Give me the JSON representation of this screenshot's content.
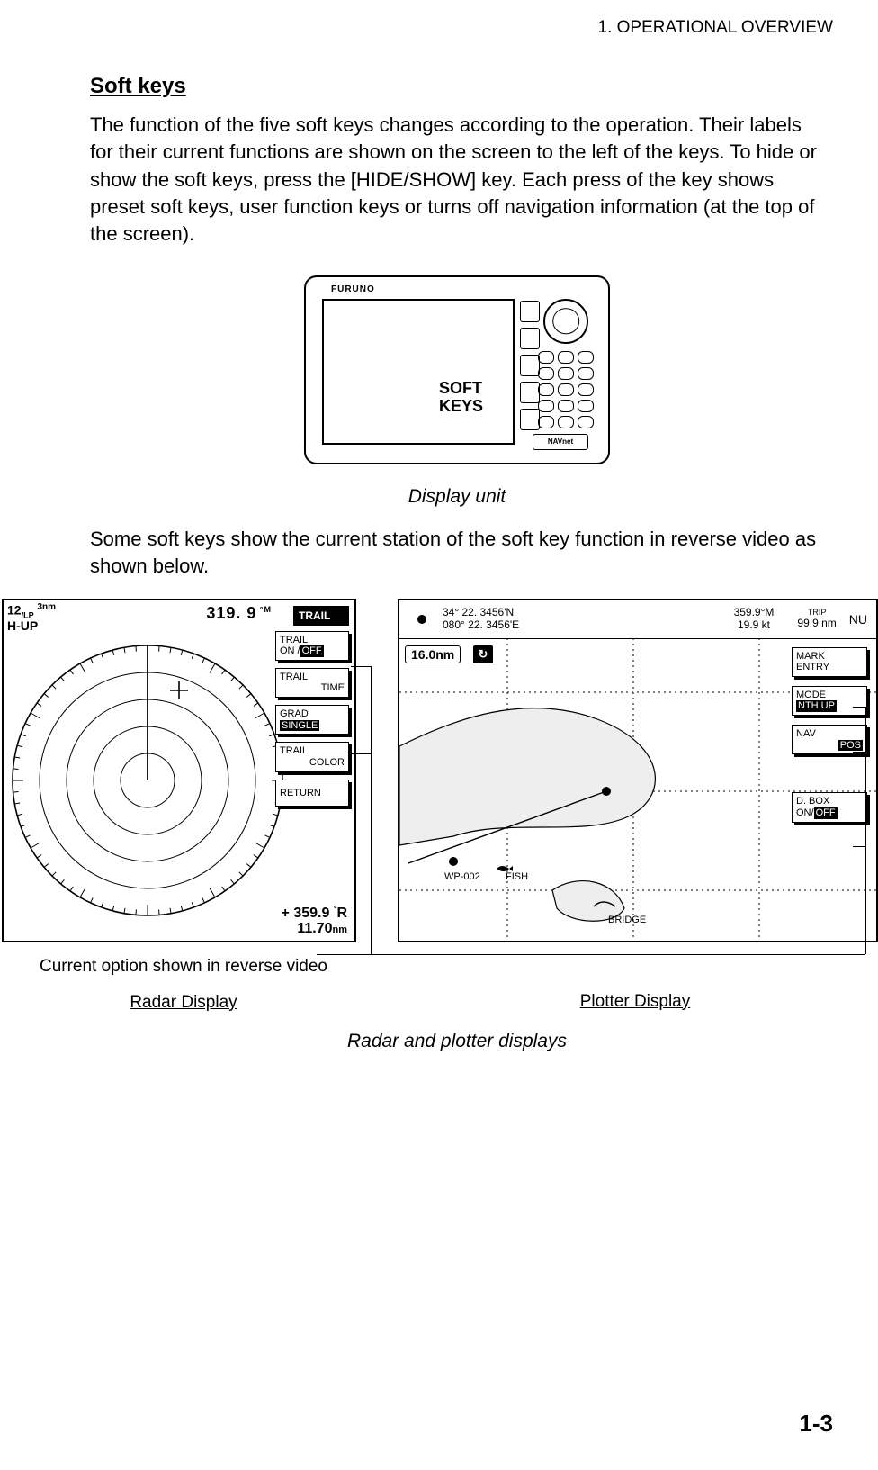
{
  "header": {
    "running": "1. OPERATIONAL OVERVIEW"
  },
  "section": {
    "title": "Soft keys"
  },
  "para1": "The function of the five soft keys changes according to the operation. Their labels for their current functions are shown on the screen to the left of the keys. To hide or show the soft keys, press the [HIDE/SHOW] key. Each press of the key shows preset soft keys, user function keys or turns off navigation information (at the top of the screen).",
  "display_unit": {
    "brand": "FURUNO",
    "softkeys_label_1": "SOFT",
    "softkeys_label_2": "KEYS",
    "logo_text": "NAVnet",
    "caption": "Display unit"
  },
  "para2": "Some soft keys show the current station of the soft key function in reverse video as shown below.",
  "radar": {
    "range": "12",
    "range_sub": "/LP",
    "range_unit": "3nm",
    "orient": "H-UP",
    "heading": "319. 9",
    "heading_unit_deg": "°",
    "heading_unit_m": "M",
    "soft_title": "TRAIL",
    "softkeys": {
      "trail_on": {
        "line1": "TRAIL",
        "line2a": "ON /",
        "line2b_inv": "OFF"
      },
      "trail_time": {
        "line1": "TRAIL",
        "line2": "TIME"
      },
      "grad": {
        "line1": "GRAD",
        "line2_inv": "SINGLE"
      },
      "trail_color": {
        "line1": "TRAIL",
        "line2": "COLOR"
      },
      "return": {
        "line1": "RETURN"
      }
    },
    "cursor": {
      "prefix": "+",
      "bearing": "359.9",
      "bearing_deg": "°",
      "bearing_r": "R",
      "range": "11.70",
      "range_unit": "nm"
    }
  },
  "plotter": {
    "lat": "34° 22. 3456'N",
    "lon": "080° 22. 3456'E",
    "hdg": "359.9°M",
    "spd": "19.9 kt",
    "trip_label": "TRIP",
    "trip": "99.9 nm",
    "nu": "NU",
    "range": "16.0nm",
    "north_glyph": "↻",
    "labels": {
      "wp": "WP-002",
      "fish": "FISH",
      "bridge": "BRIDGE"
    },
    "softkeys": {
      "mark": {
        "l1": "MARK",
        "l2": "ENTRY"
      },
      "mode": {
        "l1": "MODE",
        "l2_inv": "NTH UP"
      },
      "nav": {
        "l1": "NAV",
        "l2_inv": "POS"
      },
      "dbox": {
        "l1": "D. BOX",
        "l2a": "ON/",
        "l2b_inv": "OFF"
      }
    }
  },
  "notes": {
    "reverse_video": "Current option shown in reverse video",
    "radar_label": "Radar Display",
    "plotter_label": "Plotter Display",
    "combined_caption": "Radar and plotter displays"
  },
  "page_number": "1-3"
}
